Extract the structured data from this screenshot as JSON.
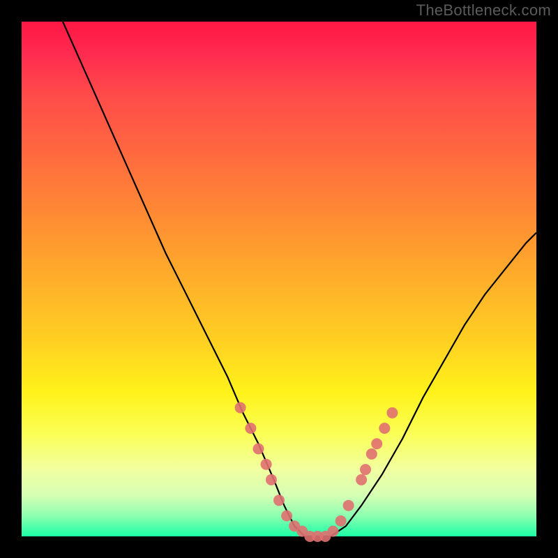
{
  "watermark": "TheBottleneck.com",
  "colors": {
    "frame": "#000000",
    "curve": "#000000",
    "markers": "#e07070",
    "gradient_stops": [
      "#ff1744",
      "#ff2a4f",
      "#ff4a4a",
      "#ff6a3f",
      "#ff8c33",
      "#ffae2a",
      "#ffd022",
      "#fff21a",
      "#fbff55",
      "#f1ffa0",
      "#d6ffb4",
      "#8dffb0",
      "#1affa6"
    ]
  },
  "chart_data": {
    "type": "line",
    "title": "",
    "xlabel": "",
    "ylabel": "",
    "xlim": [
      0,
      100
    ],
    "ylim": [
      0,
      100
    ],
    "grid": false,
    "legend": false,
    "series": [
      {
        "name": "bottleneck-curve",
        "x": [
          8,
          12,
          16,
          20,
          24,
          28,
          32,
          36,
          40,
          43,
          46,
          49,
          51,
          53,
          55,
          57,
          60,
          63,
          66,
          70,
          74,
          78,
          82,
          86,
          90,
          94,
          98,
          100
        ],
        "y": [
          100,
          91,
          82,
          73,
          64,
          55,
          47,
          39,
          31,
          24,
          18,
          11,
          6,
          2,
          0,
          0,
          0,
          2,
          6,
          12,
          19,
          27,
          34,
          41,
          47,
          52,
          57,
          59
        ]
      }
    ],
    "markers": [
      {
        "x": 42.5,
        "y": 25
      },
      {
        "x": 44.5,
        "y": 21
      },
      {
        "x": 46.0,
        "y": 17
      },
      {
        "x": 47.5,
        "y": 14
      },
      {
        "x": 48.5,
        "y": 11
      },
      {
        "x": 50.0,
        "y": 7
      },
      {
        "x": 51.5,
        "y": 4
      },
      {
        "x": 53.0,
        "y": 2
      },
      {
        "x": 54.5,
        "y": 1
      },
      {
        "x": 56.0,
        "y": 0
      },
      {
        "x": 57.5,
        "y": 0
      },
      {
        "x": 59.0,
        "y": 0
      },
      {
        "x": 60.5,
        "y": 1
      },
      {
        "x": 62.0,
        "y": 3
      },
      {
        "x": 63.5,
        "y": 6
      },
      {
        "x": 66.0,
        "y": 11
      },
      {
        "x": 66.8,
        "y": 13
      },
      {
        "x": 68.0,
        "y": 16
      },
      {
        "x": 69.0,
        "y": 18
      },
      {
        "x": 70.5,
        "y": 21
      },
      {
        "x": 72.0,
        "y": 24
      }
    ]
  }
}
